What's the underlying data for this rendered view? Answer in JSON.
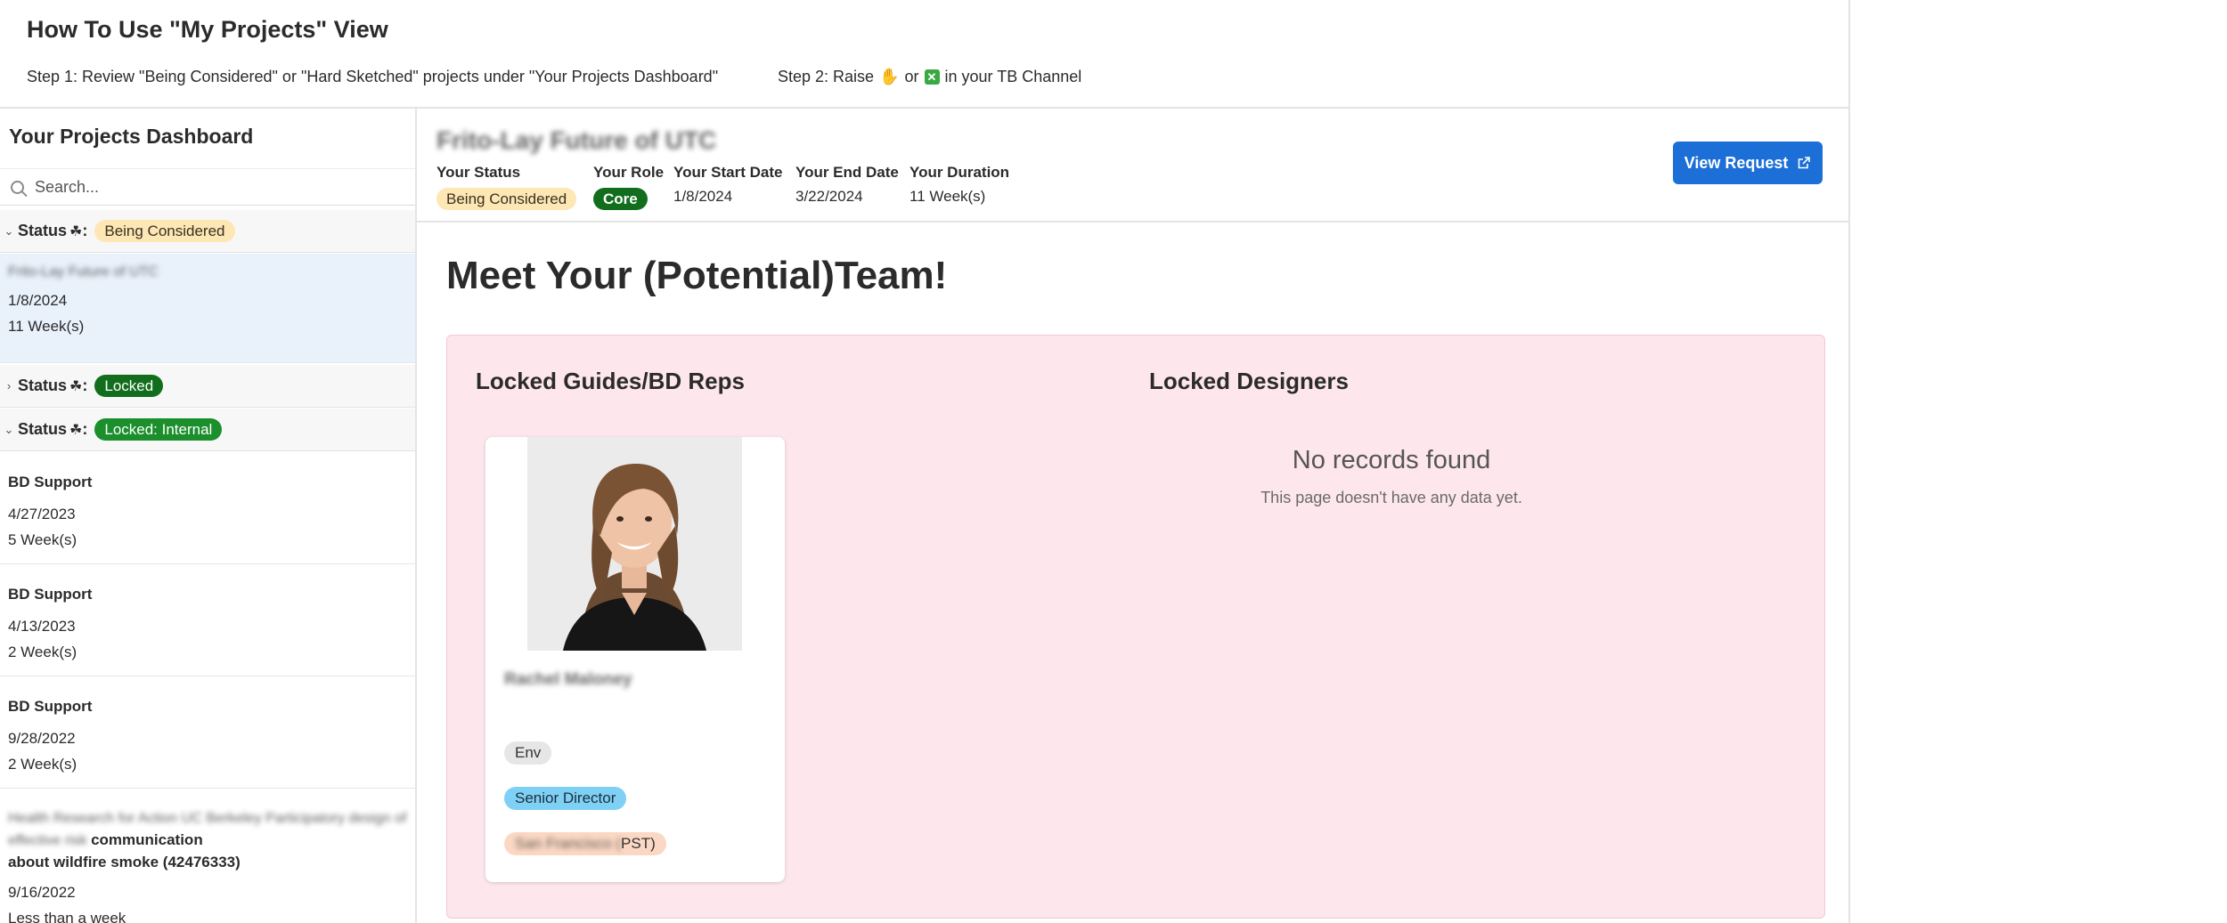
{
  "header": {
    "title": "How To Use \"My Projects\" View",
    "step1": "Step 1: Review \"Being Considered\" or \"Hard Sketched\" projects under \"Your Projects Dashboard\"",
    "step2_prefix": "Step 2: Raise",
    "step2_or": "or",
    "step2_suffix": "in your TB Channel"
  },
  "sidebar": {
    "title": "Your Projects Dashboard",
    "search_placeholder": "Search...",
    "status_label": "Status",
    "groups": [
      {
        "status": "Being Considered",
        "expanded": true,
        "items": [
          {
            "name": "Frito-Lay Future of UTC",
            "date": "1/8/2024",
            "duration": "11 Week(s)",
            "selected": true
          }
        ]
      },
      {
        "status": "Locked",
        "expanded": false
      },
      {
        "status": "Locked: Internal",
        "expanded": true,
        "items": [
          {
            "name": "BD Support",
            "date": "4/27/2023",
            "duration": "5 Week(s)"
          },
          {
            "name": "BD Support",
            "date": "4/13/2023",
            "duration": "2 Week(s)"
          },
          {
            "name": "BD Support",
            "date": "9/28/2022",
            "duration": "2 Week(s)"
          },
          {
            "name_blurred": "Health Research for Action UC Berkeley Participatory design of effective risk",
            "name_visible": "communication",
            "name_line2_blurred": "",
            "name_line2": "about wildfire smoke (42476333)",
            "date": "9/16/2022",
            "duration": "Less than a week"
          }
        ]
      }
    ]
  },
  "project": {
    "title": "Frito-Lay Future of UTC",
    "status_label": "Your Status",
    "status_value": "Being Considered",
    "role_label": "Your Role",
    "role_value": "Core",
    "start_label": "Your Start Date",
    "start_value": "1/8/2024",
    "end_label": "Your End Date",
    "end_value": "3/22/2024",
    "duration_label": "Your Duration",
    "duration_value": "11 Week(s)",
    "view_button": "View Request"
  },
  "team": {
    "title": "Meet Your (Potential)Team!",
    "guides_header": "Locked Guides/BD Reps",
    "designers_header": "Locked Designers",
    "guide_card": {
      "name": "Rachel Maloney",
      "tag_practice": "Env",
      "tag_title": "Senior Director",
      "tag_location_blurred": "San Francisco (",
      "tag_location_visible": "PST)"
    },
    "empty_title": "No records found",
    "empty_subtitle": "This page doesn't have any data yet."
  },
  "colors": {
    "accent_blue": "#1b6fd6",
    "being_considered": "#fde7b4",
    "locked_green": "#126e1d",
    "internal_green": "#1a8f2c",
    "team_panel_bg": "#fde6ec",
    "selected_row": "#e9f1fb"
  }
}
